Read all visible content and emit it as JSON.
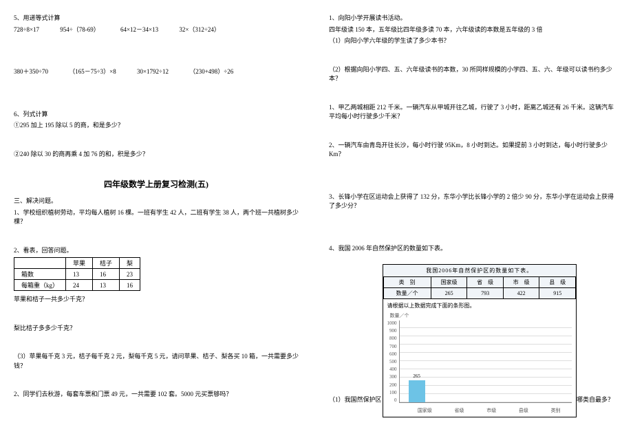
{
  "left": {
    "sec5_title": "5、用递等式计算",
    "expr_row1": {
      "a": "728÷8×17",
      "b": "954÷（78-69）",
      "c": "64×12－34×13",
      "d": "32×（312÷24）"
    },
    "expr_row2": {
      "a": "380＋350÷70",
      "b": "（165－75÷3）×8",
      "c": "30×1792÷12",
      "d": "（230+498）÷26"
    },
    "sec6_title": "6、列式计算",
    "sec6_q1": "①295 加上 195 除以 5 的商，和是多少？",
    "sec6_q2": "②240 除以 30 的商再乘 4 加 76 的和，积是多少？",
    "heading": "四年级数学上册复习检测(五)",
    "sec3_title": "三、解决问题。",
    "q1": "1、学校组织植树劳动，平均每人植树 16 棵。一班有学生 42 人，二班有学生 38 人，两个班一共植树多少棵？",
    "q2_title": "2、看表，回答问题。",
    "tbl": {
      "h0": "",
      "h1": "苹果",
      "h2": "桔子",
      "h3": "梨",
      "r1c0": "箱数",
      "r1c1": "13",
      "r1c2": "16",
      "r1c3": "23",
      "r2c0": "每箱重（kg）",
      "r2c1": "24",
      "r2c2": "13",
      "r2c3": "16"
    },
    "q2a": "苹果和桔子一共多少千克？",
    "q2b": "梨比桔子多多少千克？",
    "q2c": "（3）苹果每千克 3 元，桔子每千克 2 元，梨每千克 5 元，请问苹果、桔子、梨各买 10 箱，一共需要多少钱？",
    "q3": "2、同学们去秋游，每套车票和门票 49 元，一共需要 102 套。5000 元买票够吗？"
  },
  "right": {
    "p1a": "1、向阳小学开展读书活动。",
    "p1b": "四年级读 150 本，五年级比四年级多读 70 本，六年级读的本数是五年级的 3 倍",
    "p1c": "（1）向阳小学六年级的学生读了多少本书？",
    "p1d": "（2）根据向阳小学四、五、六年级读书的本数，30 所同样规模的小学四、五、六、年级可以读书约多少本？",
    "p2": "1、甲乙两城相距 212 千米。一辆汽车从甲城开往乙城，行驶了 3 小时，距离乙城还有 26 千米。这辆汽车平均每小时行驶多少千米？",
    "p3": "2、一辆汽车由青岛开往长沙，每小时行驶 95Km，8 小时到达。如果提前 3 小时到达，每小时行驶多少Km？",
    "p4": "3、长锋小学在区运动会上获得了 132 分，东华小学比长锋小学的 2 倍少 90 分，东华小学在运动会上获得了多少分？",
    "p5": "4、我国 2006 年自然保护区的数量如下表。",
    "q4_left": "（1）我国然保护区",
    "q4_right": "哪类自最多？"
  },
  "chart_data": {
    "type": "bar",
    "title": "我国2006年自然保护区的数量如下表。",
    "header": [
      "类　别",
      "国家级",
      "省　级",
      "市　级",
      "县　级"
    ],
    "row_label": "数量／个",
    "values_row": [
      "265",
      "793",
      "422",
      "915"
    ],
    "note": "请根据以上数据完成下面的条形图。",
    "ylabel": "数量／个",
    "yticks": [
      "1000",
      "900",
      "800",
      "700",
      "600",
      "500",
      "400",
      "300",
      "200",
      "100",
      "0"
    ],
    "categories": [
      "国家级",
      "省级",
      "市级",
      "县级",
      "类别"
    ],
    "values": [
      265,
      null,
      null,
      null,
      null
    ],
    "ylim": [
      0,
      1000
    ]
  }
}
